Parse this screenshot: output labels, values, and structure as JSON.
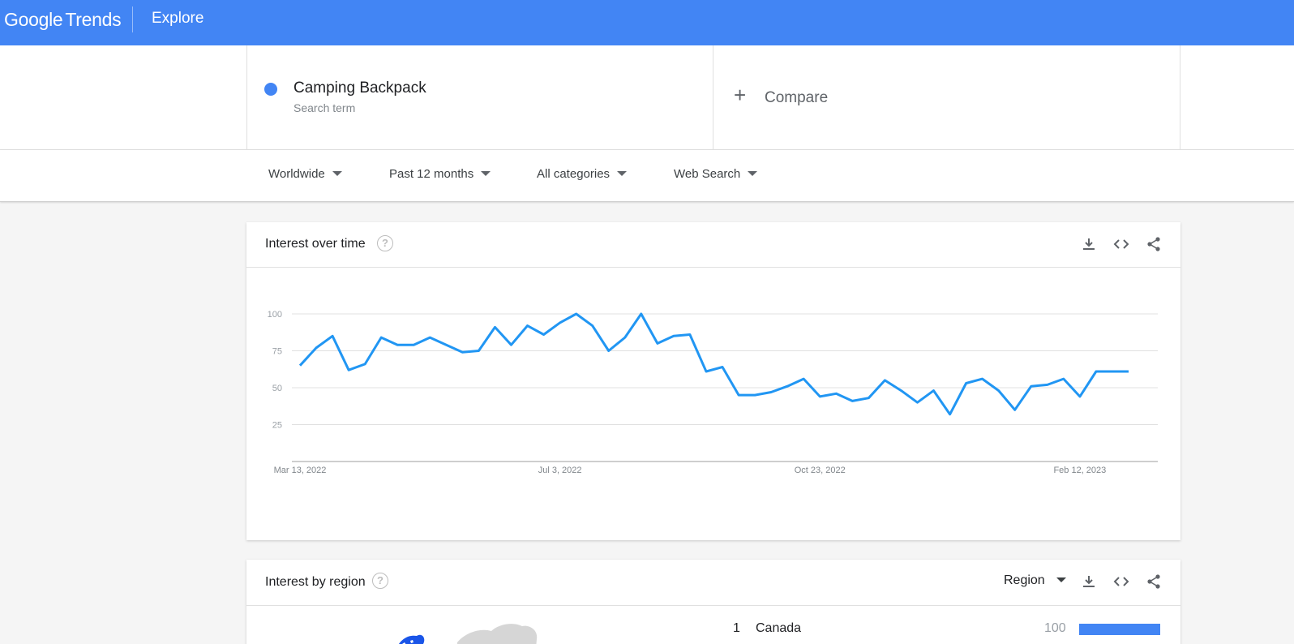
{
  "header": {
    "logo_google": "Google",
    "logo_trends": "Trends",
    "section": "Explore",
    "brand_color": "#4285f4"
  },
  "search_term": {
    "name": "Camping Backpack",
    "type": "Search term",
    "color": "#4285f4"
  },
  "compare": {
    "plus_icon": "plus-icon",
    "label": "Compare"
  },
  "filters": {
    "location": "Worldwide",
    "time": "Past 12 months",
    "category": "All categories",
    "search_type": "Web Search"
  },
  "interest_over_time": {
    "title": "Interest over time",
    "icons": [
      "help-icon",
      "download-icon",
      "embed-icon",
      "share-icon"
    ]
  },
  "chart_data": {
    "type": "line",
    "title": "",
    "xlabel": "",
    "ylabel": "",
    "ylim": [
      0,
      100
    ],
    "yticks": [
      25,
      50,
      75,
      100
    ],
    "xtick_labels": [
      "Mar 13, 2022",
      "Jul 3, 2022",
      "Oct 23, 2022",
      "Feb 12, 2023"
    ],
    "x": [
      "Mar 13, 2022",
      "Mar 20, 2022",
      "Mar 27, 2022",
      "Apr 3, 2022",
      "Apr 10, 2022",
      "Apr 17, 2022",
      "Apr 24, 2022",
      "May 1, 2022",
      "May 8, 2022",
      "May 15, 2022",
      "May 22, 2022",
      "May 29, 2022",
      "Jun 5, 2022",
      "Jun 12, 2022",
      "Jun 19, 2022",
      "Jun 26, 2022",
      "Jul 3, 2022",
      "Jul 10, 2022",
      "Jul 17, 2022",
      "Jul 24, 2022",
      "Jul 31, 2022",
      "Aug 7, 2022",
      "Aug 14, 2022",
      "Aug 21, 2022",
      "Aug 28, 2022",
      "Sep 4, 2022",
      "Sep 11, 2022",
      "Sep 18, 2022",
      "Sep 25, 2022",
      "Oct 2, 2022",
      "Oct 9, 2022",
      "Oct 16, 2022",
      "Oct 23, 2022",
      "Oct 30, 2022",
      "Nov 6, 2022",
      "Nov 13, 2022",
      "Nov 20, 2022",
      "Nov 27, 2022",
      "Dec 4, 2022",
      "Dec 11, 2022",
      "Dec 18, 2022",
      "Dec 25, 2022",
      "Jan 1, 2023",
      "Jan 8, 2023",
      "Jan 15, 2023",
      "Jan 22, 2023",
      "Jan 29, 2023",
      "Feb 5, 2023",
      "Feb 12, 2023",
      "Feb 19, 2023",
      "Feb 26, 2023",
      "Mar 5, 2023"
    ],
    "series": [
      {
        "name": "Camping Backpack",
        "color": "#2196f3",
        "values": [
          65,
          77,
          85,
          62,
          66,
          84,
          79,
          79,
          84,
          79,
          74,
          75,
          91,
          79,
          92,
          86,
          94,
          100,
          92,
          75,
          84,
          100,
          80,
          85,
          86,
          61,
          64,
          45,
          45,
          47,
          51,
          56,
          44,
          46,
          41,
          43,
          55,
          48,
          40,
          48,
          32,
          53,
          56,
          48,
          35,
          51,
          52,
          56,
          44,
          61,
          61,
          61
        ]
      }
    ],
    "grid": true,
    "legend": "none"
  },
  "interest_by_region": {
    "title": "Interest by region",
    "resolution": "Region",
    "icons": [
      "help-icon",
      "download-icon",
      "embed-icon",
      "share-icon"
    ],
    "rows": [
      {
        "rank": "1",
        "name": "Canada",
        "value": 100
      }
    ]
  }
}
